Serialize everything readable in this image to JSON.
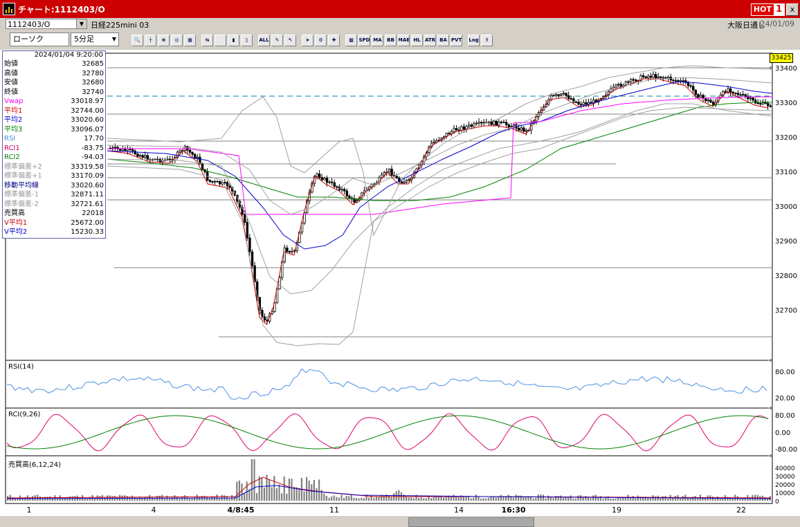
{
  "window": {
    "title": "チャート:1112403/O",
    "hot_label": "HOT",
    "hot_number": "1",
    "close": "x"
  },
  "header": {
    "code": "1112403/O",
    "name": "日経225mini 03",
    "session": "大阪日通し",
    "date": "24/01/09"
  },
  "toolbar": {
    "chart_type": "ローソク",
    "interval": "5分足",
    "buttons": [
      "search",
      "crosshair",
      "zoom",
      "zoom-in",
      "chart",
      "compare",
      "blank",
      "candle",
      "candle2",
      "ALL",
      "draw",
      "cursor",
      "arrow",
      "settings",
      "tool",
      "color",
      "SPD",
      "MA",
      "BB",
      "MAE",
      "HL",
      "ATR",
      "BA",
      "PVT",
      "Log",
      "export"
    ]
  },
  "info": {
    "datetime": "2024/01/04 9:20:00",
    "rows": [
      {
        "label": "始値",
        "value": "32685",
        "color": "#000000"
      },
      {
        "label": "高値",
        "value": "32780",
        "color": "#000000"
      },
      {
        "label": "安値",
        "value": "32680",
        "color": "#000000"
      },
      {
        "label": "終値",
        "value": "32740",
        "color": "#000000"
      },
      {
        "label": "Vwap",
        "value": "33018.97",
        "color": "#ff00ff"
      },
      {
        "label": "平均1",
        "value": "32744.00",
        "color": "#cc0000"
      },
      {
        "label": "平均2",
        "value": "33020.60",
        "color": "#0000cc"
      },
      {
        "label": "平均3",
        "value": "33096.07",
        "color": "#008000"
      },
      {
        "label": "RSI",
        "value": "17.70",
        "color": "#4a90e2"
      },
      {
        "label": "RCI1",
        "value": "-83.75",
        "color": "#cc0066"
      },
      {
        "label": "RCI2",
        "value": "-94.03",
        "color": "#008000"
      },
      {
        "label": "標準偏差+2",
        "value": "33319.58",
        "color": "#999999"
      },
      {
        "label": "標準偏差+1",
        "value": "33170.09",
        "color": "#999999"
      },
      {
        "label": "移動平均線",
        "value": "33020.60",
        "color": "#000080"
      },
      {
        "label": "標準偏差-1",
        "value": "32871.11",
        "color": "#999999"
      },
      {
        "label": "標準偏差-2",
        "value": "32721.61",
        "color": "#999999"
      },
      {
        "label": "売買高",
        "value": "22018",
        "color": "#000000"
      },
      {
        "label": "V平均1",
        "value": "25672.00",
        "color": "#cc0000"
      },
      {
        "label": "V平均2",
        "value": "15230.33",
        "color": "#0000cc"
      }
    ]
  },
  "price_axis": {
    "current": "33425",
    "labels": [
      "33400",
      "33300",
      "33200",
      "33100",
      "33000",
      "32900",
      "32800",
      "32700"
    ]
  },
  "rsi_panel": {
    "title": "RSI(14)",
    "labels": [
      "80.00",
      "20.00"
    ]
  },
  "rci_panel": {
    "title": "RCI(9,26)",
    "labels": [
      "80.00",
      "0.00",
      "-80.00"
    ]
  },
  "vol_panel": {
    "title": "売買高(6,12,24)",
    "labels": [
      "40000",
      "30000",
      "20000",
      "10000",
      "0"
    ]
  },
  "x_axis": {
    "labels": [
      "1",
      "4",
      "4/8:45",
      "11",
      "14",
      "16:30",
      "19",
      "22"
    ]
  },
  "colors": {
    "up": "#ffffff",
    "down": "#000000",
    "ma1": "#cc0000",
    "ma2": "#0000cc",
    "ma3": "#008000",
    "vwap": "#ff00ff",
    "bands": "#a0a0a0",
    "rsi": "#4a90e2",
    "rci1": "#e0006e",
    "rci2": "#008000"
  }
}
